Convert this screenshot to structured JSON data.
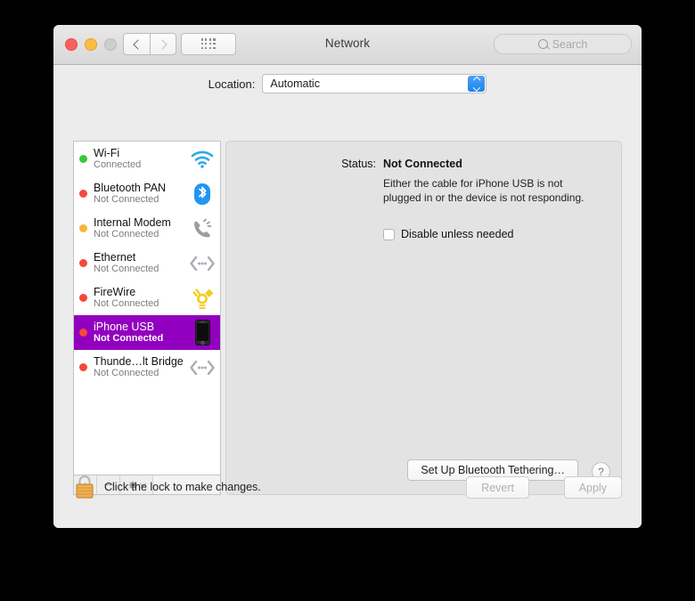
{
  "window": {
    "title": "Network",
    "traffic_lights": [
      "close",
      "minimize",
      "zoom"
    ],
    "back_label": "Back",
    "forward_label": "Forward",
    "grid_label": "Show All"
  },
  "search": {
    "placeholder": "Search",
    "value": ""
  },
  "location": {
    "label": "Location:",
    "selected": "Automatic"
  },
  "services": [
    {
      "name": "Wi-Fi",
      "status": "Connected",
      "dot": "#37c937",
      "icon": "wifi-icon",
      "selected": false
    },
    {
      "name": "Bluetooth PAN",
      "status": "Not Connected",
      "dot": "#f5483a",
      "icon": "bluetooth-icon",
      "selected": false
    },
    {
      "name": "Internal Modem",
      "status": "Not Connected",
      "dot": "#f5b63a",
      "icon": "modem-icon",
      "selected": false
    },
    {
      "name": "Ethernet",
      "status": "Not Connected",
      "dot": "#f5483a",
      "icon": "ethernet-icon",
      "selected": false
    },
    {
      "name": "FireWire",
      "status": "Not Connected",
      "dot": "#f5483a",
      "icon": "firewire-icon",
      "selected": false
    },
    {
      "name": "iPhone USB",
      "status": "Not Connected",
      "dot": "#f5483a",
      "icon": "iphone-icon",
      "selected": true
    },
    {
      "name": "Thunde…lt Bridge",
      "status": "Not Connected",
      "dot": "#f5483a",
      "icon": "thunderbolt-icon",
      "selected": false
    }
  ],
  "list_toolbar": {
    "add_label": "+",
    "remove_label": "−",
    "actions_label": "Actions"
  },
  "detail": {
    "status_label": "Status:",
    "status_value": "Not Connected",
    "status_description": "Either the cable for iPhone USB is not plugged in or the device is not responding.",
    "checkbox_label": "Disable unless needed",
    "checkbox_checked": false,
    "tethering_button": "Set Up Bluetooth Tethering…",
    "help_button": "?"
  },
  "footer": {
    "lock_text": "Click the lock to make changes.",
    "lock_state": "locked",
    "revert_label": "Revert",
    "apply_label": "Apply",
    "revert_enabled": false,
    "apply_enabled": false
  },
  "colors": {
    "selection_purple": "#9200bf",
    "accent_blue": "#1c84ef",
    "green_dot": "#37c937",
    "red_dot": "#f5483a",
    "amber_dot": "#f5b63a",
    "lock_orange": "#e8a33d"
  }
}
